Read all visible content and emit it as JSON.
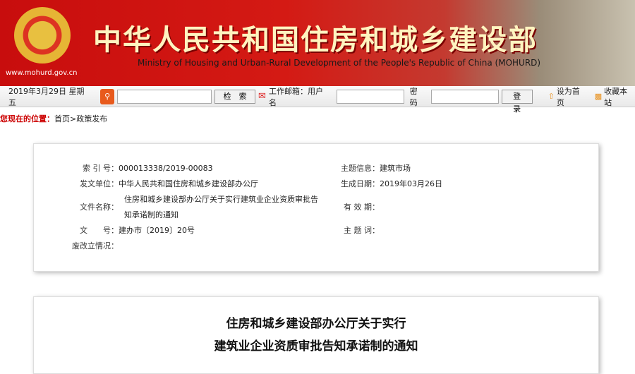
{
  "header": {
    "title_cn": "中华人民共和国住房和城乡建设部",
    "title_en": "Ministry of Housing and Urban-Rural Development of the People's Republic of China (MOHURD)",
    "site_url": "www.mohurd.gov.cn"
  },
  "toolbar": {
    "date": "2019年3月29日 星期五",
    "search_button": "检　索",
    "mail_label": "工作邮箱：用户名",
    "password_label": "密码",
    "login_button": "登录",
    "set_home": "设为首页",
    "bookmark": "收藏本站",
    "search_value": "",
    "username_value": "",
    "password_value": ""
  },
  "breadcrumb": {
    "label": "您现在的位置：",
    "path": "首页>政策发布"
  },
  "meta": {
    "index_label": "索 引 号：",
    "index_value": "000013338/2019-00083",
    "topic_label": "主题信息：",
    "topic_value": "建筑市场",
    "issuer_label": "发文单位：",
    "issuer_value": "中华人民共和国住房和城乡建设部办公厅",
    "date_label": "生成日期：",
    "date_value": "2019年03月26日",
    "name_label": "文件名称：",
    "name_line1": "住房和城乡建设部办公厅关于实行建筑业企业资质审批告",
    "name_line2": "知承诺制的通知",
    "validity_label": "有 效 期：",
    "docno_label": "文　　号：",
    "docno_value": "建办市〔2019〕20号",
    "keywords_label": "主 题 词：",
    "status_label": "废改立情况："
  },
  "article": {
    "title_line1": "住房和城乡建设部办公厅关于实行",
    "title_line2": "建筑业企业资质审批告知承诺制的通知"
  }
}
